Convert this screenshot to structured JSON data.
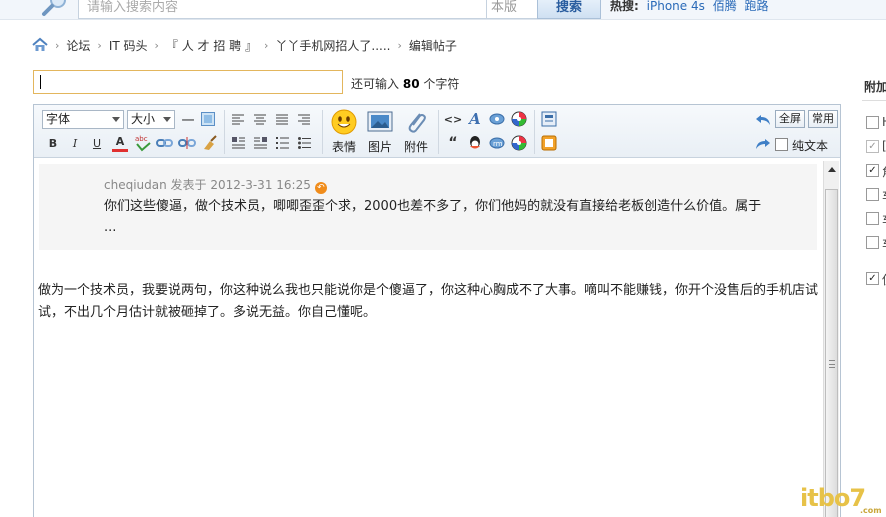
{
  "topbar": {
    "search_placeholder": "请输入搜索内容",
    "scope": "本版",
    "search_button": "搜索",
    "hot_label": "热搜:",
    "hot_links": [
      "iPhone 4s",
      "佰腾",
      "跑路"
    ]
  },
  "breadcrumb": [
    "论坛",
    "IT 码头",
    "『 人 才 招 聘 』",
    "丫丫手机网招人了.....",
    "编辑帖子"
  ],
  "title_row": {
    "remaining_prefix": "还可输入",
    "remaining_count": "80",
    "remaining_suffix": "个字符"
  },
  "toolbar": {
    "font_select": "字体",
    "size_select": "大小",
    "smiley_label": "表情",
    "image_label": "图片",
    "attach_label": "附件",
    "fullscreen_label": "全屏",
    "common_label": "常用",
    "plaintext_label": "纯文本",
    "bold": "B",
    "italic": "I",
    "underline": "U",
    "font_color": "A",
    "quote": "“",
    "code": "<>",
    "font_style": "A",
    "hr": "一"
  },
  "quote": {
    "meta": "cheqiudan 发表于 2012-3-31 16:25",
    "text": "你们这些傻逼，做个技术员，唧唧歪歪个求，2000也差不多了，你们他妈的就没有直接给老板创造什么价值。属于 ..."
  },
  "body_text": "做为一个技术员，我要说两句，你这种说么我也只能说你是个傻逼了，你这种心胸成不了大事。嘀叫不能赚钱，你开个没售后的手机店试试，不出几个月估计就被砸掉了。多说无益。你自己懂呢。",
  "side": {
    "title": "附加",
    "options": [
      {
        "label": "H",
        "checked": false,
        "disabled": false
      },
      {
        "label": "[",
        "checked": true,
        "disabled": true
      },
      {
        "label": "角",
        "checked": true,
        "disabled": false
      },
      {
        "label": "车",
        "checked": false,
        "disabled": false
      },
      {
        "label": "车",
        "checked": false,
        "disabled": false
      },
      {
        "label": "车",
        "checked": false,
        "disabled": false
      },
      {
        "label": "使",
        "checked": true,
        "disabled": false
      }
    ]
  },
  "watermark": {
    "text": "itbo7",
    "suffix": ".com"
  },
  "colors": {
    "link": "#2a6ab8",
    "title_border": "#e3b65d",
    "editor_border": "#b6c4d3",
    "quote_bg": "#f5f5f5",
    "reply_icon": "#f08c1b",
    "watermark": "#e7c248"
  }
}
